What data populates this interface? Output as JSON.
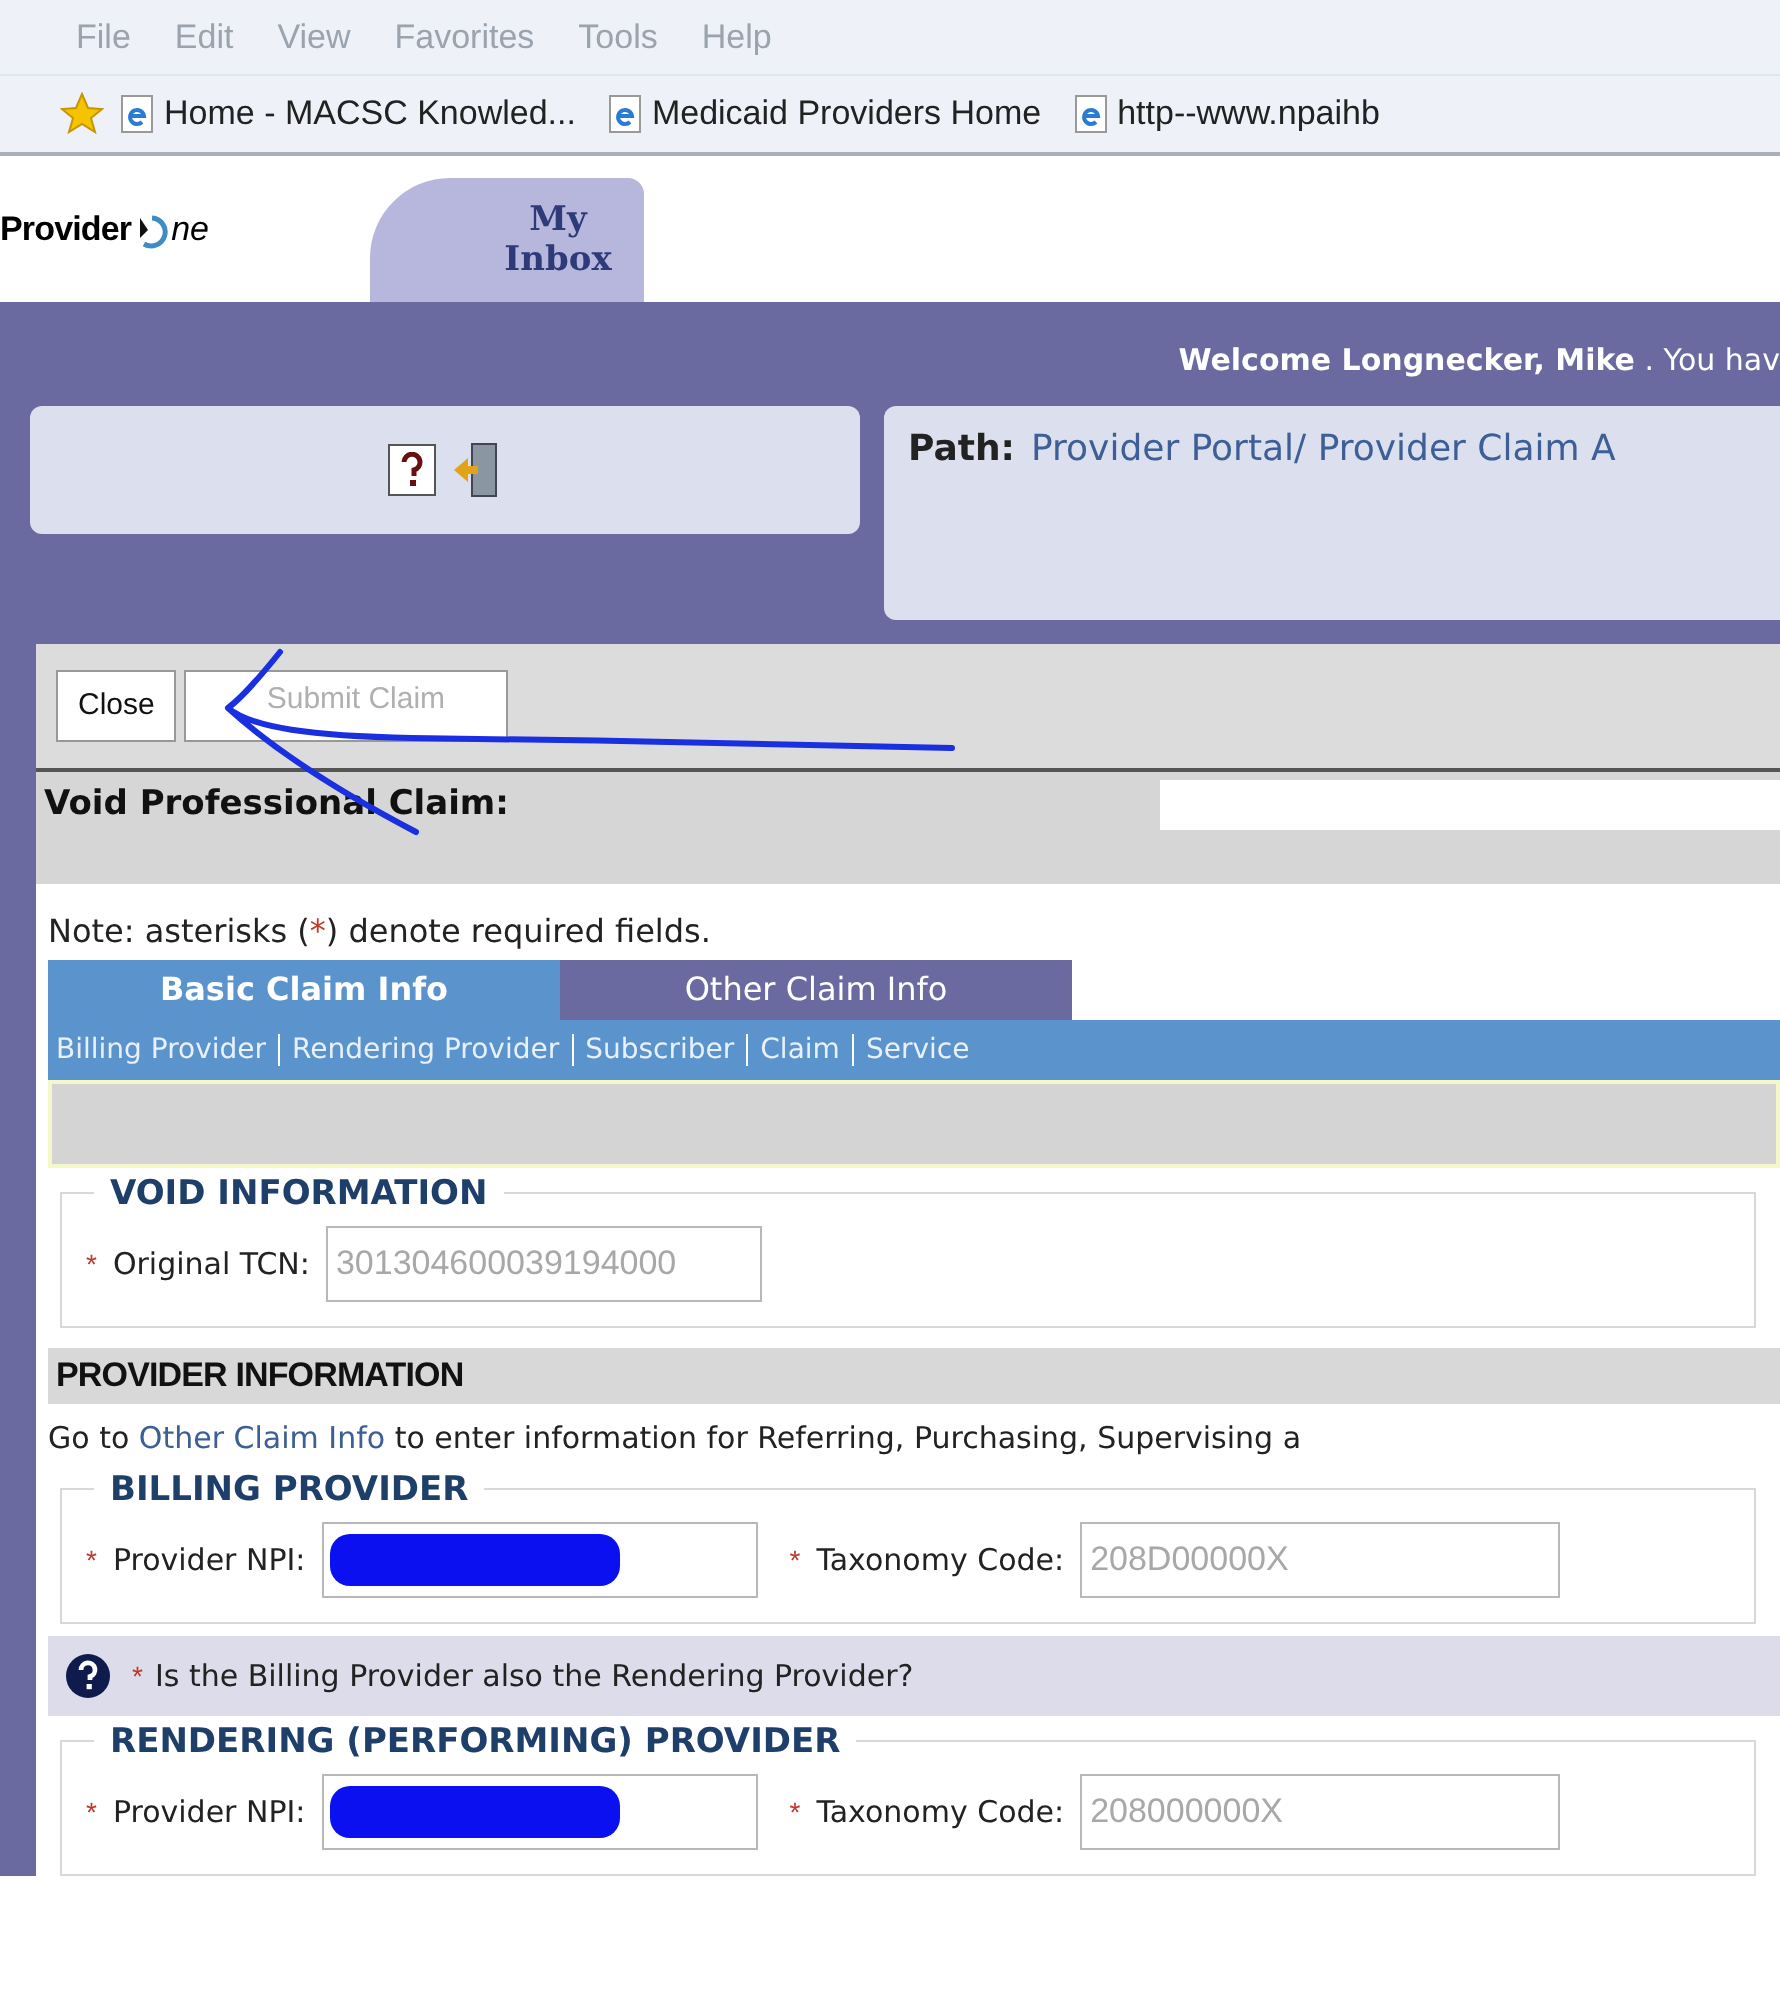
{
  "menu": [
    "File",
    "Edit",
    "View",
    "Favorites",
    "Tools",
    "Help"
  ],
  "favorites": [
    "Home - MACSC Knowled...",
    "Medicaid Providers Home",
    "http--www.npaihb"
  ],
  "logo": {
    "before": "Provider",
    "after": "ne"
  },
  "top_tabs": [
    {
      "label": "My Inbox",
      "selected": true
    }
  ],
  "welcome": "**Welcome Longnecker, Mike** . You hav",
  "path": {
    "label": "Path:",
    "value": "Provider Portal/ Provider Claim A"
  },
  "toolbar": [
    {
      "label": "Close",
      "disabled": false
    },
    {
      "label": "Submit Claim",
      "disabled": true
    }
  ],
  "claim_title": "Void Professional Claim:",
  "note": {
    "before": "Note: asterisks (",
    "mark": "*",
    "after": ") denote required fields."
  },
  "form_tabs": [
    {
      "label": "Basic Claim Info",
      "selected": true
    },
    {
      "label": "Other Claim Info",
      "selected": false
    }
  ],
  "section_links": [
    "Billing Provider",
    "Rendering Provider",
    "Subscriber",
    "Claim",
    "Service"
  ],
  "void_information": {
    "title": "VOID INFORMATION",
    "fields": [
      {
        "label": "Original TCN:",
        "required": true,
        "value": "301304600039194000",
        "redacted": false
      }
    ]
  },
  "provider_information": {
    "title": "PROVIDER INFORMATION",
    "info_before": "Go to ",
    "info_link": "Other Claim Info",
    "info_after": " to enter information for Referring, Purchasing, Supervising a"
  },
  "billing_provider": {
    "title": "BILLING PROVIDER",
    "fields": [
      {
        "label": "Provider NPI:",
        "required": true,
        "redacted": true
      },
      {
        "label": "Taxonomy Code:",
        "required": true,
        "value": "208D00000X",
        "redacted": false
      }
    ]
  },
  "question": {
    "text": "Is the Billing Provider also the Rendering Provider?",
    "required": true
  },
  "rendering_provider": {
    "title": "RENDERING (PERFORMING) PROVIDER",
    "fields": [
      {
        "label": "Provider NPI:",
        "required": true,
        "redacted": true
      },
      {
        "label": "Taxonomy Code:",
        "required": true,
        "value": "208000000X",
        "redacted": false
      }
    ]
  }
}
